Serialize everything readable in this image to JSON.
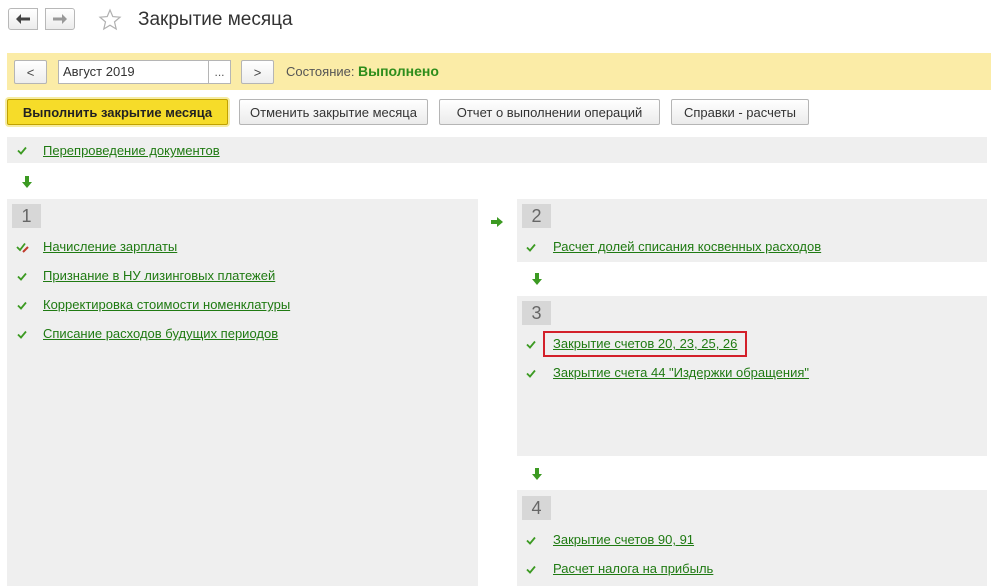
{
  "window": {
    "title": "Закрытие месяца"
  },
  "panel": {
    "prev_label": "<",
    "next_label": ">",
    "period_value": "Август 2019",
    "select_label": "...",
    "state_label": "Состояние:",
    "state_value": "Выполнено"
  },
  "toolbar": {
    "execute": "Выполнить закрытие месяца",
    "cancel": "Отменить закрытие месяца",
    "report": "Отчет о выполнении операций",
    "references": "Справки - расчеты"
  },
  "colors": {
    "accent_yellow": "#f6dc29",
    "link_green": "#1f7a12",
    "status_green": "#2d8d1b",
    "highlight_red": "#d3202a"
  },
  "pre_step": {
    "label": "Перепроведение документов"
  },
  "sections": {
    "s1": {
      "number": "1",
      "items": [
        "Начисление зарплаты",
        "Признание в НУ лизинговых платежей",
        "Корректировка стоимости номенклатуры",
        "Списание расходов будущих периодов"
      ]
    },
    "s2": {
      "number": "2",
      "items": [
        "Расчет долей списания косвенных расходов"
      ]
    },
    "s3": {
      "number": "3",
      "items": [
        "Закрытие счетов 20, 23, 25, 26",
        "Закрытие счета 44 \"Издержки обращения\""
      ]
    },
    "s4": {
      "number": "4",
      "items": [
        "Закрытие счетов 90, 91",
        "Расчет налога на прибыль"
      ]
    }
  }
}
